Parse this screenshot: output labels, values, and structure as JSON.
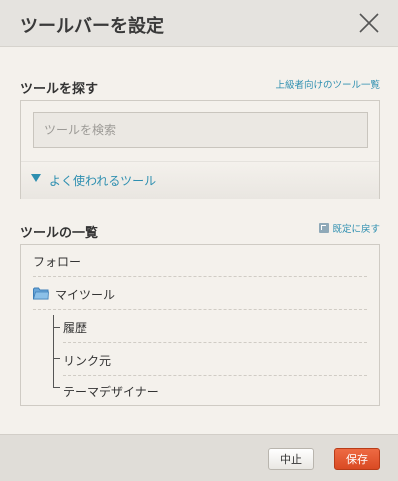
{
  "dialog": {
    "title": "ツールバーを設定",
    "close_icon": "close-icon"
  },
  "search_section": {
    "title": "ツールを探す",
    "advanced_link": "上級者向けのツール一覧",
    "search_placeholder": "ツールを検索",
    "search_value": "",
    "frequent_tools_label": "よく使われるツール",
    "frequent_toggle_icon": "triangle-down-icon"
  },
  "list_section": {
    "title": "ツールの一覧",
    "restore_link": "既定に戻す",
    "restore_icon": "restore-icon",
    "items": [
      {
        "label": "フォロー"
      },
      {
        "label": "マイツール",
        "icon": "folder-icon"
      },
      {
        "label": "履歴"
      },
      {
        "label": "リンク元"
      },
      {
        "label": "テーマデザイナー"
      }
    ]
  },
  "footer": {
    "cancel_label": "中止",
    "save_label": "保存"
  },
  "colors": {
    "accent": "#2e8fb0",
    "save_button": "#e0532a",
    "background": "#f4f1ec",
    "header": "#e5e3df"
  }
}
